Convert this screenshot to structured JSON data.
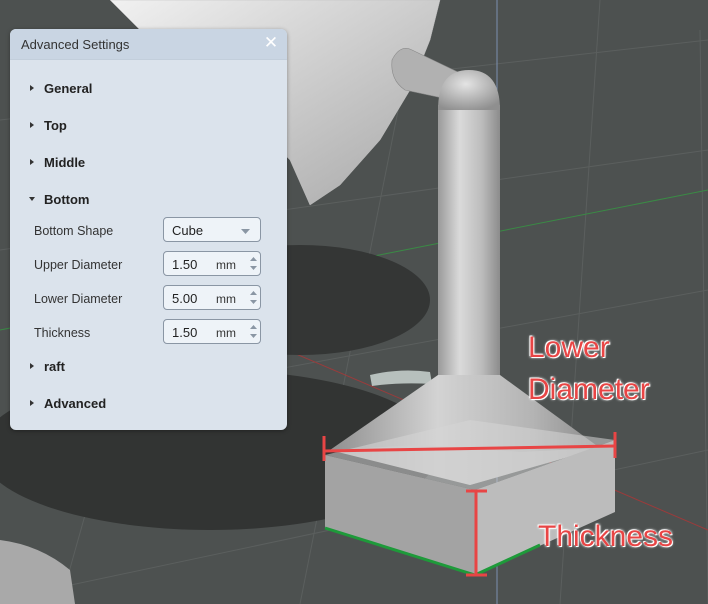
{
  "panel": {
    "title": "Advanced Settings",
    "close_symbol": "✕",
    "sections": {
      "general": "General",
      "top": "Top",
      "middle": "Middle",
      "bottom": "Bottom",
      "raft": "raft",
      "advanced": "Advanced"
    },
    "bottom_settings": {
      "shape_label": "Bottom Shape",
      "shape_value": "Cube",
      "upper_diameter_label": "Upper Diameter",
      "upper_diameter_value": "1.50",
      "lower_diameter_label": "Lower Diameter",
      "lower_diameter_value": "5.00",
      "thickness_label": "Thickness",
      "thickness_value": "1.50",
      "unit": "mm"
    }
  },
  "annotations": {
    "lower_diameter_line1": "Lower",
    "lower_diameter_line2": "Diameter",
    "thickness": "Thickness"
  },
  "colors": {
    "annotation": "#e84545",
    "axis_x": "#b33a3a",
    "axis_y": "#2f8a3a",
    "edge_highlight": "#1e9a3a"
  }
}
